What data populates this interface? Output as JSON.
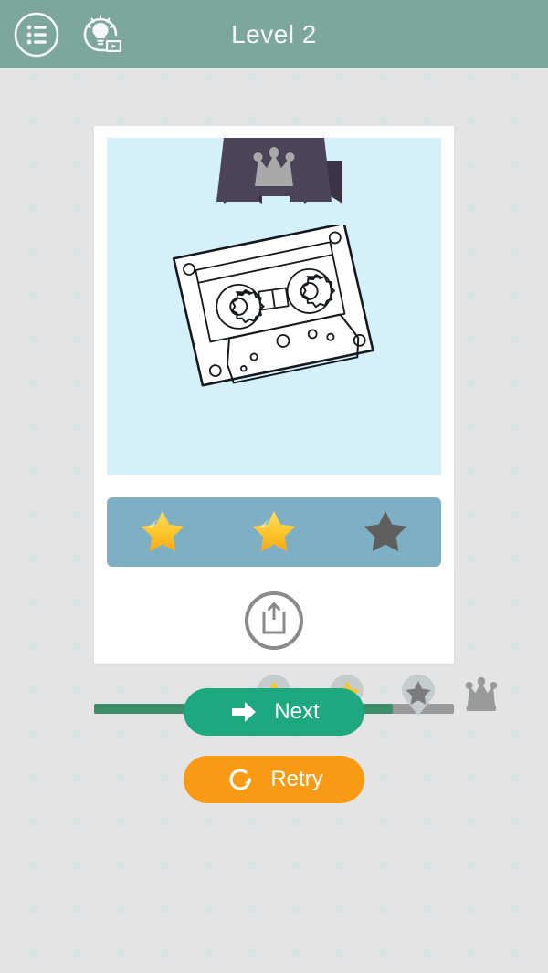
{
  "header": {
    "title": "Level 2",
    "accent_color": "#7ea79b",
    "buttons": [
      {
        "name": "levels-list-button",
        "icon": "list-circle-icon"
      },
      {
        "name": "hint-video-button",
        "icon": "lightbulb-video-icon"
      }
    ]
  },
  "card": {
    "photo": {
      "background_color": "#d4f0fb",
      "banner": {
        "icon": "crown-icon",
        "ribbon_color": "#4b4459",
        "ribbon_fold_color": "#3a3446",
        "crown_color": "#a9a9a9"
      },
      "illustration": "cassette-tape-line-drawing"
    },
    "rating": {
      "bar_color": "#7fafc4",
      "earned": 2,
      "total": 3,
      "star_filled_color": "#fcc52a",
      "star_empty_color": "#5e5e5e",
      "stars": [
        {
          "state": "filled"
        },
        {
          "state": "filled"
        },
        {
          "state": "empty"
        }
      ]
    },
    "share": {
      "icon": "share-upload-icon",
      "color": "#8a8a8a"
    }
  },
  "progress": {
    "fill_percent": 83,
    "track_color": "#9a9a9a",
    "fill_color": "#3e8e6b",
    "markers": [
      {
        "name": "progress-star-marker-1",
        "icon": "star-pin-icon",
        "state": "earned",
        "position_percent": 50
      },
      {
        "name": "progress-star-marker-2",
        "icon": "star-pin-icon",
        "state": "earned",
        "position_percent": 70
      },
      {
        "name": "progress-star-marker-3",
        "icon": "star-pin-icon",
        "state": "locked",
        "position_percent": 90
      }
    ],
    "end_reward": {
      "name": "progress-crown-reward",
      "icon": "crown-icon",
      "color": "#9a9a9a"
    }
  },
  "actions": {
    "next": {
      "label": "Next",
      "icon": "arrow-right-icon",
      "color": "#1da880"
    },
    "retry": {
      "label": "Retry",
      "icon": "refresh-icon",
      "color": "#f99a14"
    }
  }
}
